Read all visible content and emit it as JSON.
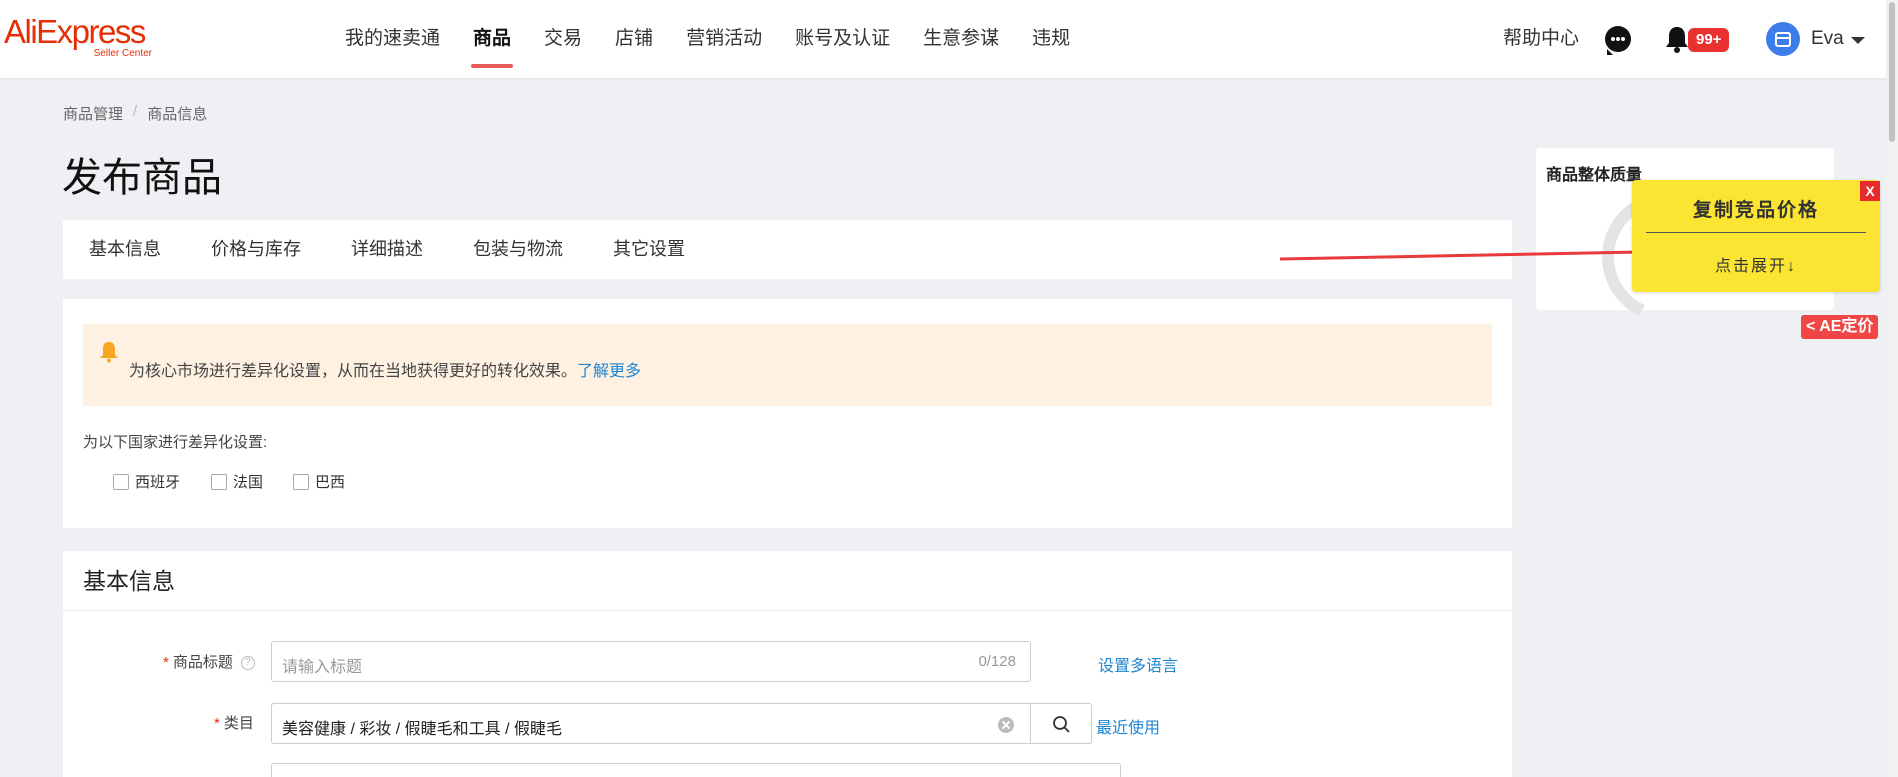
{
  "header": {
    "logo_main": "AliExpress",
    "logo_sub": "Seller Center",
    "nav": [
      "我的速卖通",
      "商品",
      "交易",
      "店铺",
      "营销活动",
      "账号及认证",
      "生意参谋",
      "违规"
    ],
    "active_nav": "商品",
    "help": "帮助中心",
    "notification_badge": "99+",
    "username": "Eva"
  },
  "breadcrumb": {
    "items": [
      "商品管理",
      "商品信息"
    ],
    "separator": "/"
  },
  "page_title": "发布商品",
  "tabs": [
    "基本信息",
    "价格与库存",
    "详细描述",
    "包装与物流",
    "其它设置"
  ],
  "localization": {
    "notice": "为核心市场进行差异化设置，从而在当地获得更好的转化效果。",
    "notice_link": "了解更多",
    "countries_label": "为以下国家进行差异化设置:",
    "countries": [
      "西班牙",
      "法国",
      "巴西"
    ]
  },
  "basic_info": {
    "heading": "基本信息",
    "required_mark": "*",
    "title_field": {
      "label": "商品标题",
      "help_icon": "?",
      "placeholder": "请输入标题",
      "counter": "0/128",
      "link": "设置多语言"
    },
    "category_field": {
      "label": "类目",
      "value": "美容健康 / 彩妆 / 假睫毛和工具 / 假睫毛",
      "link": "最近使用"
    }
  },
  "quality_panel": {
    "title": "商品整体质量"
  },
  "popup": {
    "title": "复制竞品价格",
    "expand": "点击展开↓",
    "close": "X"
  },
  "ae_price_tab": "< AE定价",
  "colors": {
    "brand": "#e62e04",
    "active_underline": "#e85a56",
    "link": "#1d86d4",
    "notice_bg": "#fef1e2",
    "popup_bg": "#fce433",
    "badge": "#e9312f"
  }
}
